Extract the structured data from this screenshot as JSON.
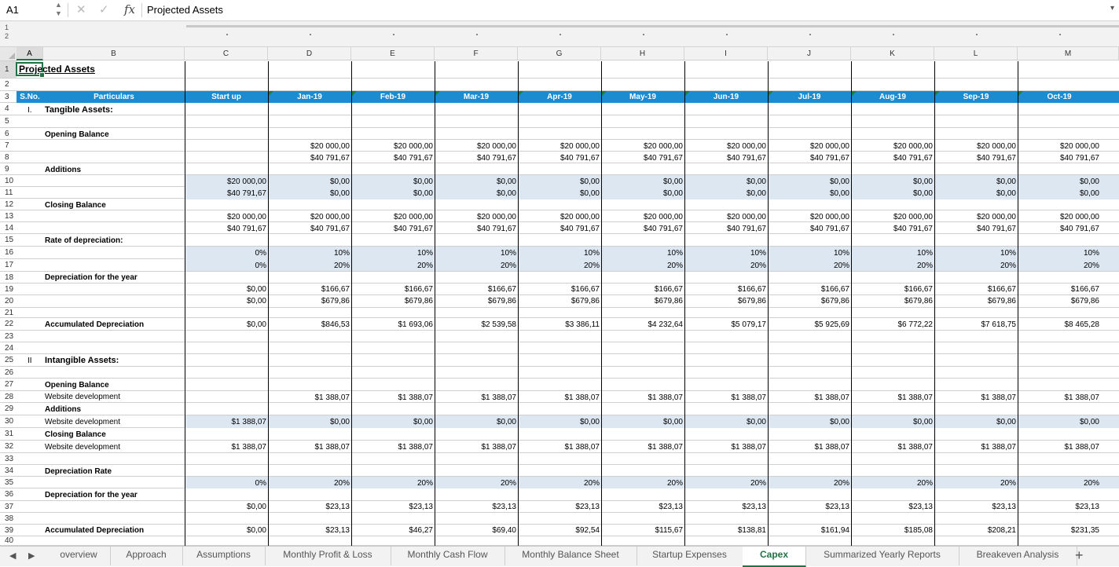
{
  "formula_bar": {
    "cell_ref": "A1",
    "fx": "fx",
    "content": "Projected Assets"
  },
  "outline_levels": [
    "1",
    "2"
  ],
  "columns": [
    "A",
    "B",
    "C",
    "D",
    "E",
    "F",
    "G",
    "H",
    "I",
    "J",
    "K",
    "L",
    "M"
  ],
  "row_numbers": [
    "1",
    "2",
    "3",
    "4",
    "5",
    "6",
    "7",
    "8",
    "9",
    "10",
    "11",
    "12",
    "13",
    "14",
    "15",
    "16",
    "17",
    "18",
    "19",
    "20",
    "21",
    "22",
    "23",
    "24",
    "25",
    "26",
    "27",
    "28",
    "29",
    "30",
    "31",
    "32",
    "33",
    "34",
    "35",
    "36",
    "37",
    "38",
    "39",
    "40"
  ],
  "sheet": {
    "title": "Projected Assets",
    "header": {
      "sno": "S.No.",
      "particulars": "Particulars",
      "months": [
        "Start up",
        "Jan-19",
        "Feb-19",
        "Mar-19",
        "Apr-19",
        "May-19",
        "Jun-19",
        "Jul-19",
        "Aug-19",
        "Sep-19",
        "Oct-19"
      ]
    },
    "sno_tangible": "I.",
    "sno_intangible": "II",
    "labels": {
      "tangible": "Tangible Assets:",
      "opening": "Opening Balance",
      "additions": "Additions",
      "closing": "Closing Balance",
      "rate": "Rate of depreciation:",
      "dep_year": "Depreciation for the year",
      "accum": "Accumulated Depreciation",
      "intangible": "Intangible Assets:",
      "i_opening": "Opening Balance",
      "website1": "Website development",
      "i_additions": "Additions",
      "website2": "Website development",
      "i_closing": "Closing Balance",
      "website3": "Website development",
      "dep_rate": "Depreciation Rate",
      "i_dep_year": "Depreciation for the year",
      "i_accum": "Accumulated Depreciation"
    },
    "rows": {
      "r7": [
        "",
        "$20 000,00",
        "$20 000,00",
        "$20 000,00",
        "$20 000,00",
        "$20 000,00",
        "$20 000,00",
        "$20 000,00",
        "$20 000,00",
        "$20 000,00",
        "$20 000,00"
      ],
      "r8": [
        "",
        "$40 791,67",
        "$40 791,67",
        "$40 791,67",
        "$40 791,67",
        "$40 791,67",
        "$40 791,67",
        "$40 791,67",
        "$40 791,67",
        "$40 791,67",
        "$40 791,67"
      ],
      "r10": [
        "$20 000,00",
        "$0,00",
        "$0,00",
        "$0,00",
        "$0,00",
        "$0,00",
        "$0,00",
        "$0,00",
        "$0,00",
        "$0,00",
        "$0,00"
      ],
      "r11": [
        "$40 791,67",
        "$0,00",
        "$0,00",
        "$0,00",
        "$0,00",
        "$0,00",
        "$0,00",
        "$0,00",
        "$0,00",
        "$0,00",
        "$0,00"
      ],
      "r13": [
        "$20 000,00",
        "$20 000,00",
        "$20 000,00",
        "$20 000,00",
        "$20 000,00",
        "$20 000,00",
        "$20 000,00",
        "$20 000,00",
        "$20 000,00",
        "$20 000,00",
        "$20 000,00"
      ],
      "r14": [
        "$40 791,67",
        "$40 791,67",
        "$40 791,67",
        "$40 791,67",
        "$40 791,67",
        "$40 791,67",
        "$40 791,67",
        "$40 791,67",
        "$40 791,67",
        "$40 791,67",
        "$40 791,67"
      ],
      "r16": [
        "0%",
        "10%",
        "10%",
        "10%",
        "10%",
        "10%",
        "10%",
        "10%",
        "10%",
        "10%",
        "10%"
      ],
      "r17": [
        "0%",
        "20%",
        "20%",
        "20%",
        "20%",
        "20%",
        "20%",
        "20%",
        "20%",
        "20%",
        "20%"
      ],
      "r19": [
        "$0,00",
        "$166,67",
        "$166,67",
        "$166,67",
        "$166,67",
        "$166,67",
        "$166,67",
        "$166,67",
        "$166,67",
        "$166,67",
        "$166,67"
      ],
      "r20": [
        "$0,00",
        "$679,86",
        "$679,86",
        "$679,86",
        "$679,86",
        "$679,86",
        "$679,86",
        "$679,86",
        "$679,86",
        "$679,86",
        "$679,86"
      ],
      "r22": [
        "$0,00",
        "$846,53",
        "$1 693,06",
        "$2 539,58",
        "$3 386,11",
        "$4 232,64",
        "$5 079,17",
        "$5 925,69",
        "$6 772,22",
        "$7 618,75",
        "$8 465,28"
      ],
      "r28": [
        "",
        "$1 388,07",
        "$1 388,07",
        "$1 388,07",
        "$1 388,07",
        "$1 388,07",
        "$1 388,07",
        "$1 388,07",
        "$1 388,07",
        "$1 388,07",
        "$1 388,07"
      ],
      "r30": [
        "$1 388,07",
        "$0,00",
        "$0,00",
        "$0,00",
        "$0,00",
        "$0,00",
        "$0,00",
        "$0,00",
        "$0,00",
        "$0,00",
        "$0,00"
      ],
      "r32": [
        "$1 388,07",
        "$1 388,07",
        "$1 388,07",
        "$1 388,07",
        "$1 388,07",
        "$1 388,07",
        "$1 388,07",
        "$1 388,07",
        "$1 388,07",
        "$1 388,07",
        "$1 388,07"
      ],
      "r35": [
        "0%",
        "20%",
        "20%",
        "20%",
        "20%",
        "20%",
        "20%",
        "20%",
        "20%",
        "20%",
        "20%"
      ],
      "r37": [
        "$0,00",
        "$23,13",
        "$23,13",
        "$23,13",
        "$23,13",
        "$23,13",
        "$23,13",
        "$23,13",
        "$23,13",
        "$23,13",
        "$23,13"
      ],
      "r39": [
        "$0,00",
        "$23,13",
        "$46,27",
        "$69,40",
        "$92,54",
        "$115,67",
        "$138,81",
        "$161,94",
        "$185,08",
        "$208,21",
        "$231,35"
      ]
    }
  },
  "tabs": [
    "overview",
    "Approach",
    "Assumptions",
    "Monthly Profit & Loss",
    "Monthly Cash Flow",
    "Monthly Balance Sheet",
    "Startup Expenses",
    "Capex",
    "Summarized Yearly Reports",
    "Breakeven Analysis"
  ],
  "active_tab": "Capex",
  "add_sheet": "+",
  "icons": {
    "prev": "◀",
    "next": "▶",
    "cancel": "✕",
    "confirm": "✓",
    "dropdown": "▾"
  },
  "colors": {
    "header_blue": "#1b8cd0",
    "input_shade": "#dde7f2",
    "excel_green": "#217346"
  }
}
